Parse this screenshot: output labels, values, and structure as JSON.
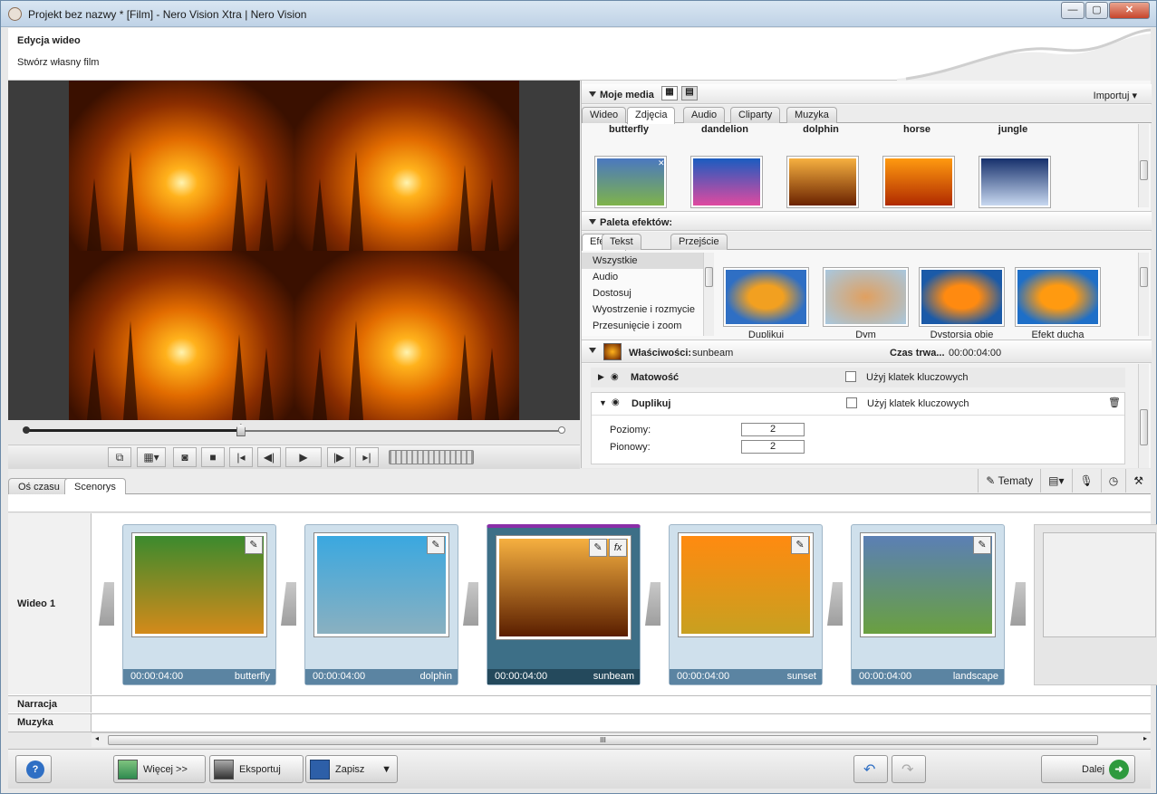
{
  "window": {
    "title": "Projekt bez nazwy * [Film] - Nero Vision Xtra | Nero Vision",
    "minimize": "—",
    "maximize": "▢",
    "close": "✕"
  },
  "header": {
    "title": "Edycja wideo",
    "subtitle": "Stwórz własny film"
  },
  "media": {
    "title": "Moje media",
    "import": "Importuj",
    "tabs": [
      "Wideo",
      "Zdjęcia",
      "Audio",
      "Cliparty",
      "Muzyka"
    ],
    "active_tab": "Zdjęcia",
    "items": [
      {
        "label": "butterfly",
        "colors": [
          "#4a78c0",
          "#7fb34a"
        ]
      },
      {
        "label": "dandelion",
        "colors": [
          "#1a5cc0",
          "#e04aa0"
        ]
      },
      {
        "label": "dolphin",
        "colors": [
          "#f6b040",
          "#6a2200"
        ]
      },
      {
        "label": "horse",
        "colors": [
          "#ff9a10",
          "#b02a00"
        ]
      },
      {
        "label": "jungle",
        "colors": [
          "#16306c",
          "#c8d8f0"
        ]
      }
    ]
  },
  "effects": {
    "title": "Paleta efektów:",
    "tabs": [
      "Efekty",
      "Tekst",
      "Przejście"
    ],
    "active_tab": "Efekty",
    "categories": [
      "Wszystkie",
      "Audio",
      "Dostosuj",
      "Wyostrzenie i rozmycie",
      "Przesunięcie i zoom"
    ],
    "selected_category": "Wszystkie",
    "items": [
      {
        "label": "Duplikuj"
      },
      {
        "label": "Dym"
      },
      {
        "label": "Dystorsja obie"
      },
      {
        "label": "Efekt ducha"
      }
    ]
  },
  "properties": {
    "title": "Właściwości:",
    "clip": "sunbeam",
    "duration_label": "Czas trwa...",
    "duration": "00:00:04:00",
    "rows": [
      {
        "name": "Matowość",
        "keyframes": "Użyj klatek kluczowych"
      },
      {
        "name": "Duplikuj",
        "keyframes": "Użyj klatek kluczowych"
      }
    ],
    "fields": [
      {
        "label": "Poziomy:",
        "value": "2"
      },
      {
        "label": "Pionowy:",
        "value": "2"
      }
    ]
  },
  "timeline": {
    "tabs": [
      "Oś czasu",
      "Scenorys"
    ],
    "active_tab": "Scenorys",
    "tools": {
      "themes": "Tematy"
    },
    "tracks": [
      "Wideo 1",
      "Narracja",
      "Muzyka"
    ],
    "clips": [
      {
        "name": "butterfly",
        "duration": "00:00:04:00",
        "colors": [
          "#3b8a2e",
          "#d48a1a"
        ]
      },
      {
        "name": "dolphin",
        "duration": "00:00:04:00",
        "colors": [
          "#3aa8e0",
          "#8ab0c0"
        ]
      },
      {
        "name": "sunbeam",
        "duration": "00:00:04:00",
        "colors": [
          "#f6b040",
          "#5a1e00"
        ],
        "active": true
      },
      {
        "name": "sunset",
        "duration": "00:00:04:00",
        "colors": [
          "#ff8a10",
          "#c8a020"
        ]
      },
      {
        "name": "landscape",
        "duration": "00:00:04:00",
        "colors": [
          "#5b7fb5",
          "#6aa040"
        ]
      }
    ],
    "scroll_grip": "III"
  },
  "footer": {
    "help": "?",
    "more": "Więcej >>",
    "export": "Eksportuj",
    "save": "Zapisz",
    "next": "Dalej"
  },
  "playback": {
    "position": 0.4
  }
}
